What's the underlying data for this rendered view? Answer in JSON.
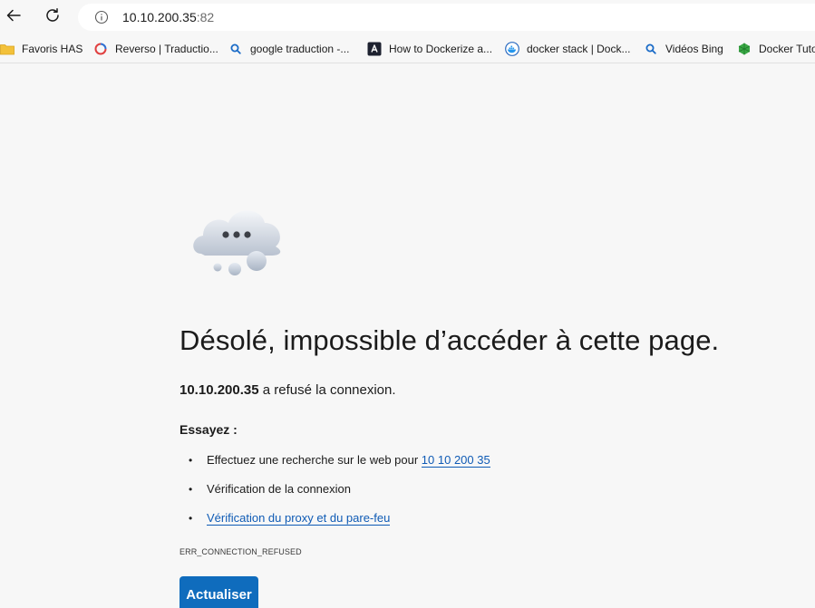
{
  "toolbar": {
    "back_icon": "arrow-left-icon",
    "reload_icon": "reload-icon",
    "url_host": "10.10.200.35",
    "url_port": ":82"
  },
  "favorites": [
    {
      "label": "Favoris HAS",
      "icon": "folder-icon"
    },
    {
      "label": "Reverso | Traductio...",
      "icon": "reverso-icon"
    },
    {
      "label": "google traduction -...",
      "icon": "search-icon"
    },
    {
      "label": "How to Dockerize a...",
      "icon": "site-icon"
    },
    {
      "label": "docker stack | Dock...",
      "icon": "docker-icon"
    },
    {
      "label": "Vidéos Bing",
      "icon": "search-icon"
    },
    {
      "label": "Docker Tuto",
      "icon": "docker-tuto-icon"
    }
  ],
  "error": {
    "title": "Désolé, impossible d’accéder à cette page.",
    "host": "10.10.200.35",
    "refused_suffix": " a refusé la connexion.",
    "try_label": "Essayez :",
    "suggestion_search_prefix": "Effectuez une recherche sur le web pour ",
    "suggestion_search_link": "10 10 200 35",
    "suggestion_check_connection": "Vérification de la connexion",
    "suggestion_proxy_link": "Vérification du proxy et du pare-feu",
    "error_code": "ERR_CONNECTION_REFUSED",
    "reload_button": "Actualiser"
  },
  "colors": {
    "background": "#f7f7f7",
    "link": "#0f5bb5",
    "button": "#0f6cbd"
  }
}
